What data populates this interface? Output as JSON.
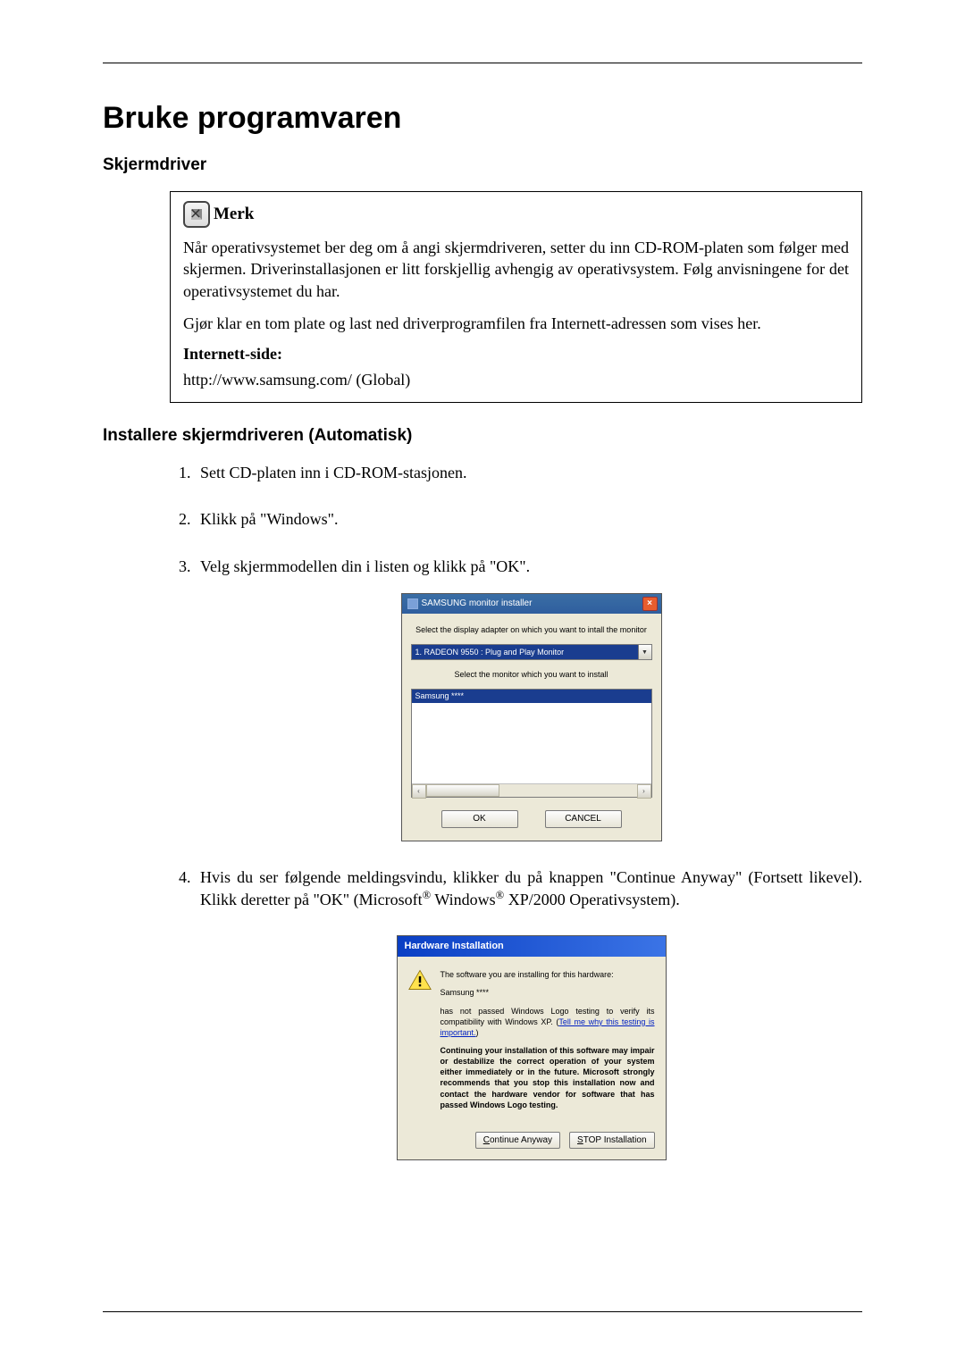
{
  "title": "Bruke programvaren",
  "section1_heading": "Skjermdriver",
  "note": {
    "title": "Merk",
    "p1": "Når operativsystemet ber deg om å angi skjermdriveren, setter du inn CD-ROM-platen som følger med skjermen. Driverinstallasjonen er litt forskjellig avhengig av operativsystem. Følg anvisningene for det operativsystemet du har.",
    "p2": "Gjør klar en tom plate og last ned driverprogramfilen fra Internett-adressen som vises her.",
    "label": "Internett-side:",
    "url": "http://www.samsung.com/ (Global)"
  },
  "section2_heading": "Installere skjermdriveren (Automatisk)",
  "steps": {
    "s1": "Sett CD-platen inn i CD-ROM-stasjonen.",
    "s2": "Klikk på \"Windows\".",
    "s3": "Velg skjermmodellen din i listen og klikk på \"OK\".",
    "s4_a": "Hvis du ser følgende meldingsvindu, klikker du på knappen \"Continue Anyway\" (Fortsett likevel). Klikk deretter på \"OK\" (Microsoft",
    "s4_b": " Windows",
    "s4_c": " XP/2000 Operativsystem)."
  },
  "installer_dialog": {
    "title": "SAMSUNG monitor installer",
    "label_adapter": "Select the display adapter on which you want to intall the monitor",
    "adapter_selected": "1. RADEON 9550 : Plug and Play Monitor",
    "label_monitor": "Select the monitor which you want to install",
    "monitor_selected": "Samsung ****",
    "ok": "OK",
    "cancel": "CANCEL"
  },
  "hardware_dialog": {
    "title": "Hardware Installation",
    "line1": "The software you are installing for this hardware:",
    "line2": "Samsung ****",
    "line3a": "has not passed Windows Logo testing to verify its compatibility with Windows XP. (",
    "link": "Tell me why this testing is important.",
    "line3b": ")",
    "bold": "Continuing your installation of this software may impair or destabilize the correct operation of your system either immediately or in the future. Microsoft strongly recommends that you stop this installation now and contact the hardware vendor for software that has passed Windows Logo testing.",
    "btn_continue": "Continue Anyway",
    "btn_stop": "STOP Installation"
  },
  "reg_mark": "®"
}
